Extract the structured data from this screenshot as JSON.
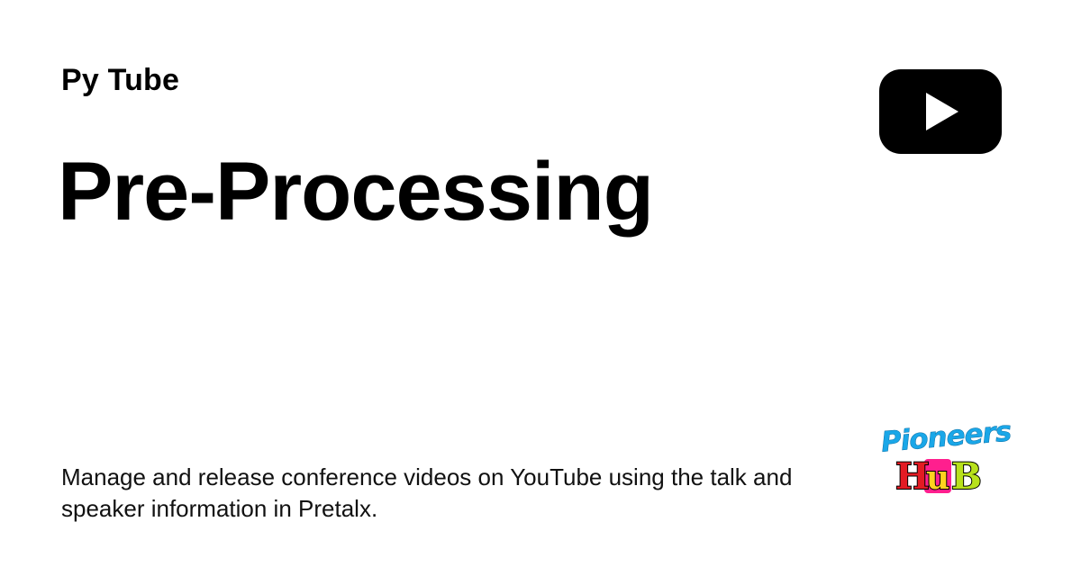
{
  "site_name": "Py Tube",
  "title": "Pre-Processing",
  "description": "Manage and release conference videos on YouTube using the talk and speaker information in Pretalx.",
  "logos": {
    "top": {
      "icon": "play-button-icon",
      "color": "#000000",
      "triangle_color": "#ffffff"
    },
    "bottom": {
      "icon": "pioneers-hub-logo",
      "word_top": "Pioneers",
      "word_bottom": "HuB",
      "colors": {
        "script": "#1aa7e8",
        "h_letter": "#e31b23",
        "u_letter": "#ffd21f",
        "u_block": "#ff1f8e",
        "b_letter": "#b8e11c",
        "outline": "#000000"
      }
    }
  }
}
